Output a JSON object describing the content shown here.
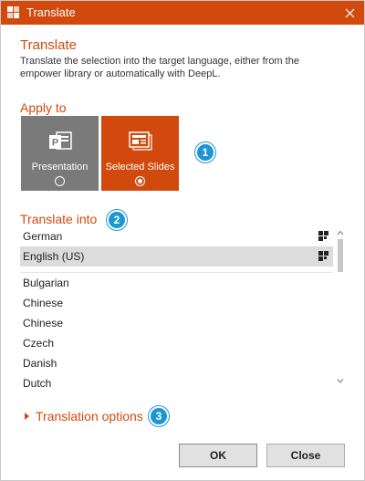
{
  "window": {
    "title": "Translate",
    "accent_color": "#d2490e",
    "badge_color": "#1e96d3"
  },
  "header": {
    "heading": "Translate",
    "description": "Translate the selection into the target language, either from the empower library or automatically with DeepL."
  },
  "apply_to": {
    "label": "Apply to",
    "options": [
      {
        "label": "Presentation",
        "icon": "powerpoint-icon",
        "selected": false
      },
      {
        "label": "Selected Slides",
        "icon": "slides-icon",
        "selected": true
      }
    ]
  },
  "translate_into": {
    "label": "Translate into",
    "languages": [
      {
        "name": "German",
        "deepl": true,
        "selected": false
      },
      {
        "name": "English (US)",
        "deepl": true,
        "selected": true
      },
      {
        "name": "Bulgarian",
        "deepl": false,
        "selected": false
      },
      {
        "name": "Chinese",
        "deepl": false,
        "selected": false
      },
      {
        "name": "Chinese",
        "deepl": false,
        "selected": false
      },
      {
        "name": "Czech",
        "deepl": false,
        "selected": false
      },
      {
        "name": "Danish",
        "deepl": false,
        "selected": false
      },
      {
        "name": "Dutch",
        "deepl": false,
        "selected": false
      }
    ]
  },
  "translation_options": {
    "label": "Translation options"
  },
  "badges": [
    "1",
    "2",
    "3"
  ],
  "buttons": {
    "ok": "OK",
    "close": "Close"
  }
}
